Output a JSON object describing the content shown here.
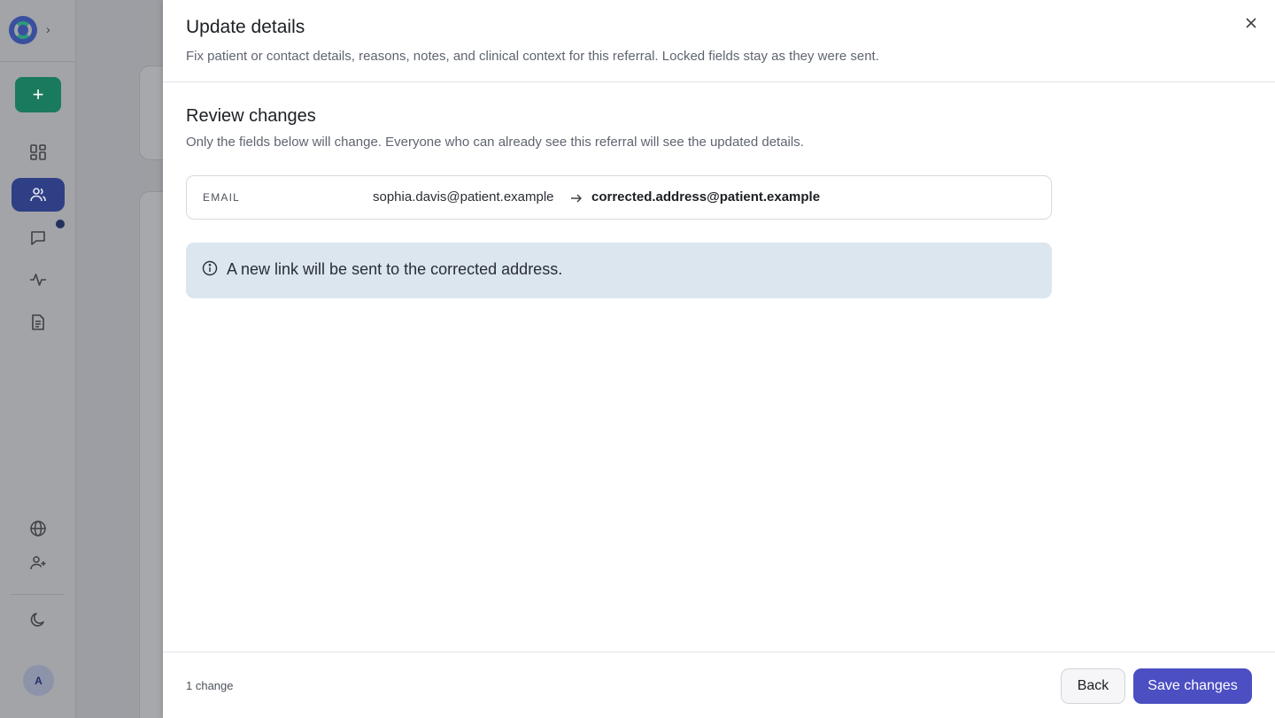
{
  "sidebar": {
    "expand_glyph": "›",
    "new_glyph": "+",
    "nav_icons": [
      "dashboard-icon",
      "people-icon",
      "chat-icon",
      "activity-icon",
      "document-icon"
    ],
    "bottom_icons": [
      "globe-icon",
      "add-user-icon",
      "moon-icon"
    ],
    "avatar_initial": "A",
    "active_item": "people-icon",
    "accent_color": "#1a7a5e"
  },
  "drawer": {
    "title": "Update details",
    "subtitle": "Fix patient or contact details, reasons, notes, and clinical context for this referral. Locked fields stay as they were sent.",
    "review": {
      "title": "Review changes",
      "description": "Only the fields below will change. Everyone who can already see this referral will see the updated details.",
      "changes": [
        {
          "field": "EMAIL",
          "old_value": "sophia.davis@patient.example",
          "new_value": "corrected.address@patient.example"
        }
      ]
    },
    "info": {
      "icon": "info-icon",
      "text": "A new link will be sent to the corrected address."
    },
    "footer": {
      "change_count": "1 change",
      "back_label": "Back",
      "save_label": "Save changes",
      "primary_color": "#4b4fc2"
    }
  }
}
